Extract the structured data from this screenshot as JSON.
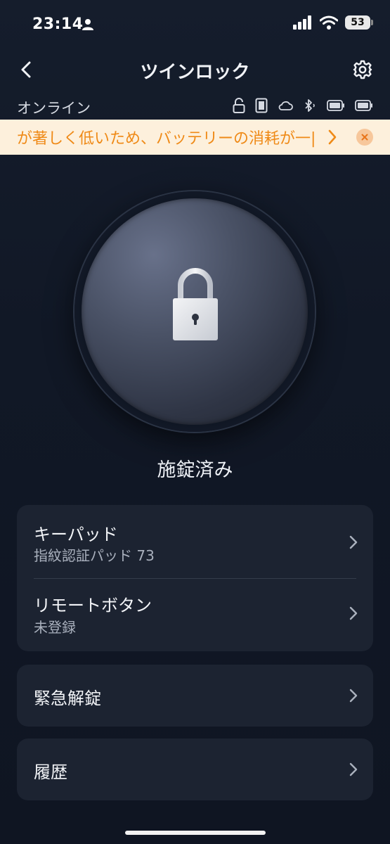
{
  "status_bar": {
    "time": "23:14",
    "battery": "53"
  },
  "header": {
    "title": "ツインロック"
  },
  "connection": {
    "status": "オンライン"
  },
  "banner": {
    "text": "が著しく低いため、バッテリーの消耗が一|"
  },
  "lock": {
    "status": "施錠済み"
  },
  "menu": {
    "keypad": {
      "title": "キーパッド",
      "subtitle": "指紋認証パッド 73"
    },
    "remote": {
      "title": "リモートボタン",
      "subtitle": "未登録"
    },
    "emergency": {
      "title": "緊急解錠"
    },
    "history": {
      "title": "履歴"
    }
  },
  "colors": {
    "background": "#121a28",
    "banner_bg": "#fdf0dc",
    "banner_text": "#ef8a17",
    "card_bg": "#1c2331"
  }
}
